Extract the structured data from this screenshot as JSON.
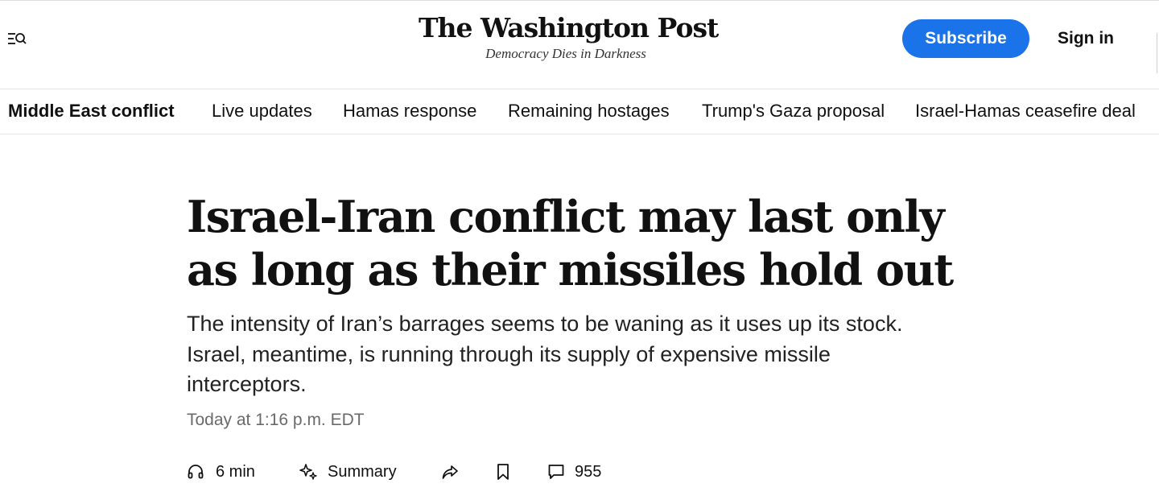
{
  "header": {
    "menu_icon": "menu-search-icon",
    "logo_text": "The Washington Post",
    "tagline": "Democracy Dies in Darkness",
    "subscribe_label": "Subscribe",
    "signin_label": "Sign in",
    "accent_color": "#1a73e8"
  },
  "topic_nav": {
    "section": "Middle East conflict",
    "links": [
      "Live updates",
      "Hamas response",
      "Remaining hostages",
      "Trump's Gaza proposal",
      "Israel-Hamas ceasefire deal"
    ]
  },
  "article": {
    "headline": "Israel-Iran conflict may last only as long as their missiles hold out",
    "dek": "The intensity of Iran’s barrages seems to be waning as it uses up its stock. Israel, meantime, is running through its supply of expensive missile interceptors.",
    "timestamp": "Today at 1:16 p.m. EDT"
  },
  "actions": {
    "listen": {
      "icon": "headphones-icon",
      "label": "6 min"
    },
    "summary": {
      "icon": "sparkle-icon",
      "label": "Summary"
    },
    "share": {
      "icon": "share-arrow-icon"
    },
    "save": {
      "icon": "bookmark-icon"
    },
    "comments": {
      "icon": "comment-icon",
      "count": "955"
    }
  }
}
